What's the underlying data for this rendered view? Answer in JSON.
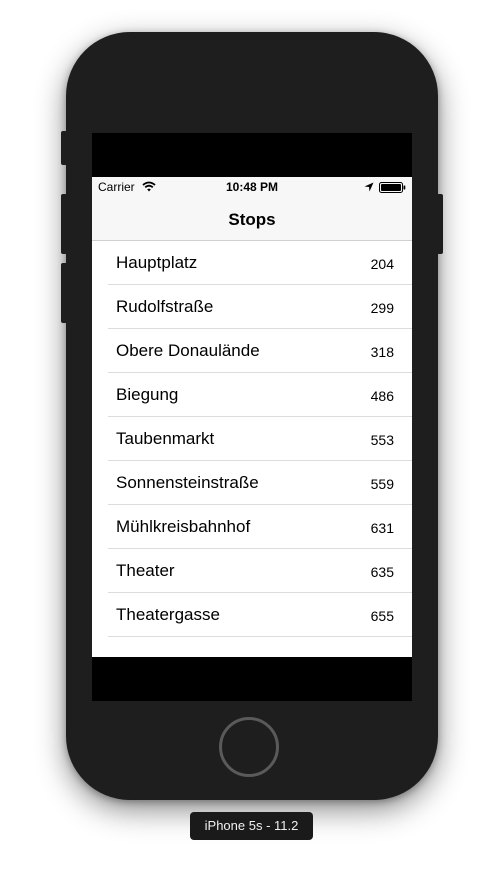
{
  "status_bar": {
    "carrier": "Carrier",
    "time": "10:48 PM",
    "icons": [
      "wifi-icon",
      "location-arrow-icon",
      "battery-icon"
    ]
  },
  "nav": {
    "title": "Stops"
  },
  "stops": [
    {
      "name": "Hauptplatz",
      "count": "204"
    },
    {
      "name": "Rudolfstraße",
      "count": "299"
    },
    {
      "name": "Obere Donaulände",
      "count": "318"
    },
    {
      "name": "Biegung",
      "count": "486"
    },
    {
      "name": "Taubenmarkt",
      "count": "553"
    },
    {
      "name": "Sonnensteinstraße",
      "count": "559"
    },
    {
      "name": "Mühlkreisbahnhof",
      "count": "631"
    },
    {
      "name": "Theater",
      "count": "635"
    },
    {
      "name": "Theatergasse",
      "count": "655"
    }
  ],
  "device_label": "iPhone 5s - 11.2",
  "colors": {
    "device_body": "#1e1e1e",
    "nav_background": "#f7f7f7",
    "separator": "#dcdcdc"
  }
}
